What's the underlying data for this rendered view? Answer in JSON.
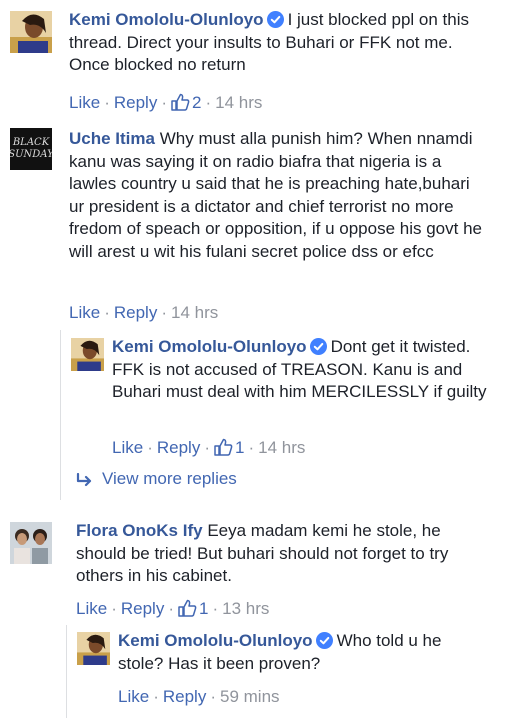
{
  "comments": [
    {
      "author": "Kemi Omololu-Olunloyo",
      "text": "I just blocked ppl on this thread. Direct your insults to Buhari or FFK not me. Once blocked no return",
      "like_label": "Like",
      "reply_label": "Reply",
      "likes": "2",
      "time": "14 hrs"
    },
    {
      "author": "Uche Itima",
      "text": "Why must alla punish him? When nnamdi kanu was saying it on radio biafra that nigeria is a lawles country u said that he is preaching hate,buhari ur president is a dictator and chief terrorist no more fredom of speach or opposition, if u oppose his govt he will arest u wit his fulani secret police dss or efcc",
      "avatar_line1": "BLACK",
      "avatar_line2": "SUNDAY",
      "like_label": "Like",
      "reply_label": "Reply",
      "time": "14 hrs"
    },
    {
      "author": "Kemi Omololu-Olunloyo",
      "text": "Dont get it twisted. FFK is not accused of TREASON. Kanu is and Buhari must deal with him MERCILESSLY if guilty",
      "like_label": "Like",
      "reply_label": "Reply",
      "likes": "1",
      "time": "14 hrs"
    },
    {
      "author": "Flora OnoKs Ify",
      "text": "Eeya madam kemi he stole, he should be tried! But buhari should not forget to try others in his cabinet.",
      "like_label": "Like",
      "reply_label": "Reply",
      "likes": "1",
      "time": "13 hrs"
    },
    {
      "author": "Kemi Omololu-Olunloyo",
      "text": "Who told u he stole? Has it been proven?",
      "like_label": "Like",
      "reply_label": "Reply",
      "time": "59 mins"
    }
  ],
  "view_more_label": "View more replies",
  "colors": {
    "link": "#4267b2",
    "author": "#365899",
    "meta": "#90949c",
    "verified": "#4080ff"
  },
  "icons": {
    "verified": "verified-badge-icon",
    "like": "thumbs-up-icon",
    "reply_arrow": "reply-arrow-icon"
  }
}
